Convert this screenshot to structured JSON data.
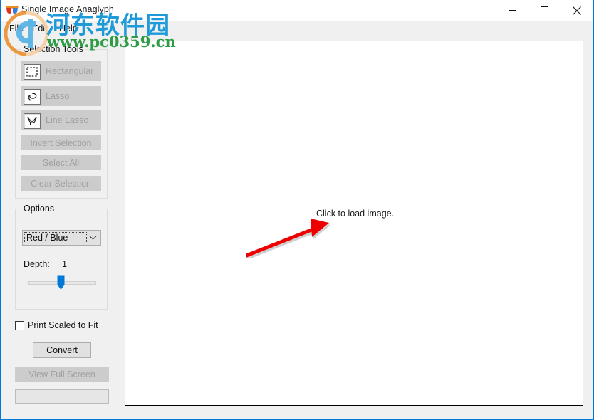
{
  "window": {
    "title": "Single Image Anaglyph",
    "app_icon": "anaglyph-glasses-icon",
    "accent_color": "#0078d7",
    "controls": {
      "minimize": "minimize-icon",
      "maximize": "maximize-icon",
      "close": "close-icon"
    }
  },
  "menubar": {
    "items": [
      {
        "label": "File"
      },
      {
        "label": "Edit"
      },
      {
        "label": "Help"
      }
    ]
  },
  "selection_tools": {
    "title": "Selection Tools",
    "buttons": [
      {
        "label": "Rectangular",
        "icon": "rectangular-marquee-icon",
        "enabled": false
      },
      {
        "label": "Lasso",
        "icon": "lasso-icon",
        "enabled": false
      },
      {
        "label": "Line Lasso",
        "icon": "line-lasso-icon",
        "enabled": false
      },
      {
        "label": "Invert Selection",
        "enabled": false
      },
      {
        "label": "Select All",
        "enabled": false
      },
      {
        "label": "Clear Selection",
        "enabled": false
      }
    ]
  },
  "options": {
    "title": "Options",
    "mode": {
      "selected": "Red / Blue",
      "arrow_icon": "chevron-down-icon"
    },
    "depth": {
      "label": "Depth:",
      "value": "1",
      "slider_percent": 48,
      "thumb_color": "#0078d7"
    }
  },
  "actions": {
    "print_scaled": {
      "label": "Print Scaled to Fit",
      "checked": false
    },
    "convert": {
      "label": "Convert",
      "enabled": true
    },
    "view_full_screen": {
      "label": "View Full Screen",
      "enabled": false
    },
    "progress": {
      "value": 0
    }
  },
  "canvas": {
    "hint": "Click to load image.",
    "annotation": {
      "icon": "red-arrow-annotation",
      "color": "#ee0000"
    }
  },
  "watermark": {
    "site_name": "河东软件园",
    "url": "www.pc0359.cn",
    "logo": "pc0359-logo-icon",
    "name_color": "#1f9ad9",
    "url_color": "#2e9b45"
  }
}
